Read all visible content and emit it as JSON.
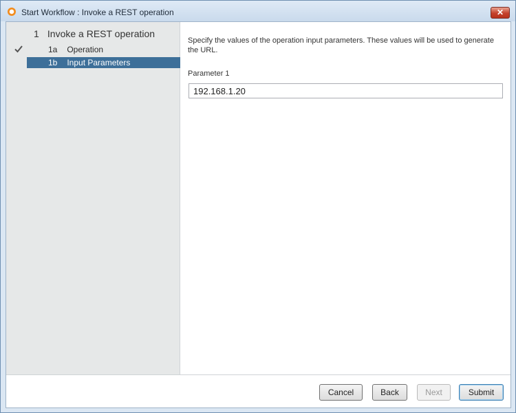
{
  "window": {
    "title": "Start Workflow : Invoke a REST operation",
    "close_label": "✕"
  },
  "sidebar": {
    "step": {
      "number": "1",
      "label": "Invoke a REST operation"
    },
    "substeps": [
      {
        "number": "1a",
        "label": "Operation",
        "completed": true,
        "active": false
      },
      {
        "number": "1b",
        "label": "Input Parameters",
        "completed": false,
        "active": true
      }
    ]
  },
  "main": {
    "description": "Specify the values of the operation input parameters. These values will be used to generate the URL.",
    "parameter_label": "Parameter 1",
    "parameter_value": "192.168.1.20"
  },
  "footer": {
    "cancel_label": "Cancel",
    "back_label": "Back",
    "next_label": "Next",
    "submit_label": "Submit"
  },
  "colors": {
    "active_item": "#3d6f99",
    "sidebar_bg": "#e6e8e8",
    "close_button": "#c4412c"
  }
}
